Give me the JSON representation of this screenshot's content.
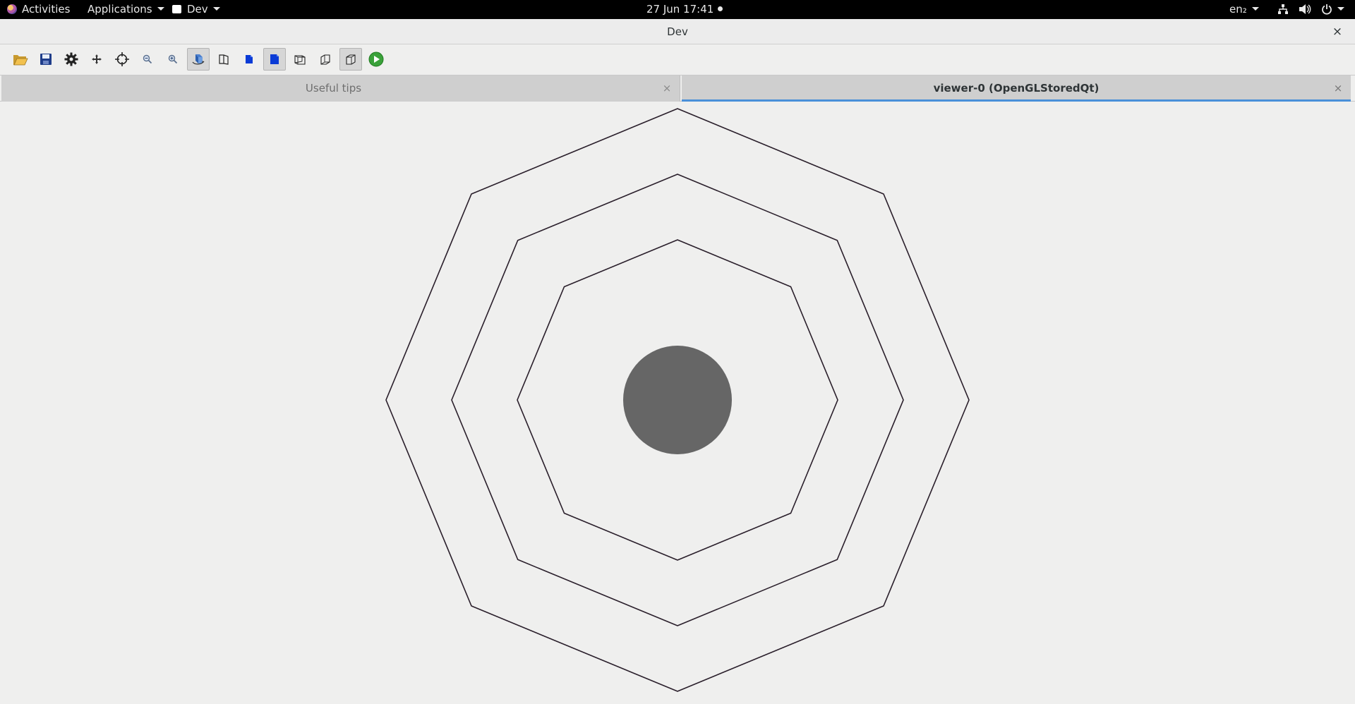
{
  "topbar": {
    "activities": "Activities",
    "applications": "Applications",
    "window_menu": "Dev",
    "clock": "27 Jun  17:41",
    "language": "en₂"
  },
  "window": {
    "title": "Dev",
    "close_glyph": "×"
  },
  "toolbar": {
    "tools": [
      {
        "name": "open-folder-icon",
        "active": false
      },
      {
        "name": "save-icon",
        "active": false
      },
      {
        "name": "settings-gear-icon",
        "active": false
      },
      {
        "name": "move-arrows-icon",
        "active": false
      },
      {
        "name": "target-crosshair-icon",
        "active": false
      },
      {
        "name": "zoom-out-icon",
        "active": false
      },
      {
        "name": "zoom-in-icon",
        "active": false
      },
      {
        "name": "rotate-view-icon",
        "active": true
      },
      {
        "name": "view-perspective-icon",
        "active": false
      },
      {
        "name": "solid-blue-icon",
        "active": false
      },
      {
        "name": "solid-blue-selected-icon",
        "active": true
      },
      {
        "name": "wireframe-icon",
        "active": false
      },
      {
        "name": "hidden-line-icon",
        "active": false
      },
      {
        "name": "hidden-surface-icon",
        "active": true
      },
      {
        "name": "run-play-icon",
        "active": false
      }
    ]
  },
  "tabs": [
    {
      "label": "Useful tips",
      "close": "×",
      "selected": false
    },
    {
      "label": "viewer-0 (OpenGLStoredQt)",
      "close": "×",
      "selected": true
    }
  ],
  "viewer": {
    "outline_color": "#2a1f2b",
    "disk_color": "#666666"
  }
}
